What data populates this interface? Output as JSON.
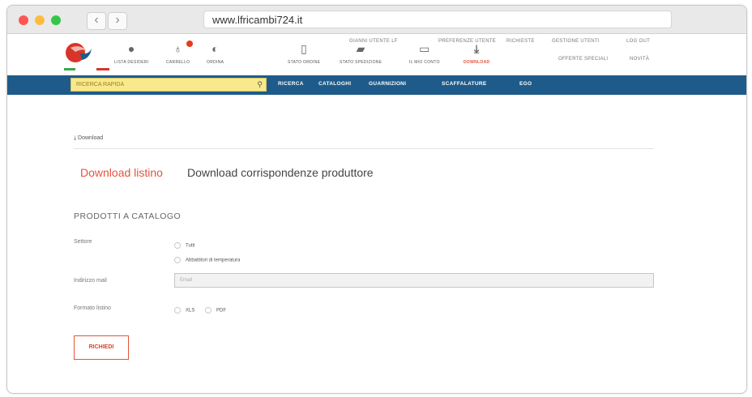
{
  "browser": {
    "url": "www.lfricambi724.it",
    "back_label": "‹",
    "forward_label": "›"
  },
  "header": {
    "actions": [
      {
        "label": "LISTA DESIDERI",
        "icon": "heart-icon"
      },
      {
        "label": "CARRELLO",
        "icon": "cart-icon"
      },
      {
        "label": "ORDINA",
        "icon": "order-icon"
      }
    ],
    "status_links": [
      {
        "label": "STATO ORDINE",
        "icon": "order-status-icon"
      },
      {
        "label": "STATO SPEDIZIONE",
        "icon": "truck-icon"
      },
      {
        "label": "IL MIO CONTO",
        "icon": "calendar-icon"
      },
      {
        "label": "DOWNLOAD",
        "icon": "download-icon",
        "active": true
      }
    ],
    "top_links": {
      "users": "GIANNI UTENTE LF",
      "prefs": "PREFERENZE UTENTE",
      "requests": "RICHIESTE",
      "manage": "GESTIONE UTENTI",
      "logout": "LOG OUT",
      "offers": "OFFERTE SPECIALI",
      "news": "NOVITÀ"
    }
  },
  "menu": {
    "search_placeholder": "RICERCA RAPIDA",
    "items": [
      "RICERCA",
      "CATALOGHI",
      "GUARNIZIONI",
      "SCAFFALATURE",
      "EGO"
    ]
  },
  "breadcrumb": "Download",
  "tabs": {
    "active": "Download listino",
    "inactive": "Download corrispondenze produttore"
  },
  "form": {
    "section_title": "PRODOTTI A CATALOGO",
    "sector_label": "Settore",
    "sector_options": [
      "Tutti",
      "Abbattitori di temperatura"
    ],
    "email_label": "Indirizzo mail",
    "email_placeholder": "Email",
    "format_label": "Formato listino",
    "format_options": [
      "XLS",
      "PDF"
    ],
    "submit_label": "RICHIEDI"
  },
  "colors": {
    "menubar": "#1e5b8a",
    "accent": "#e5533a",
    "search_bg": "#f7e98c"
  }
}
